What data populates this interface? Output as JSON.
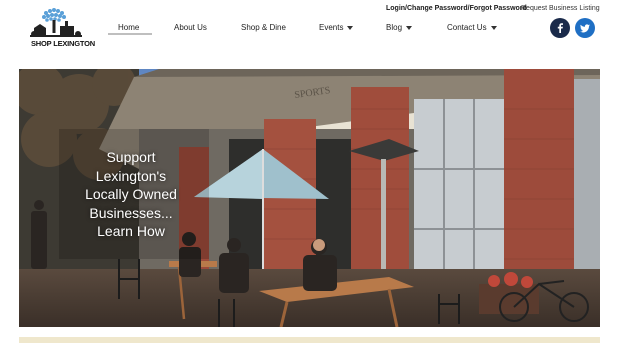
{
  "logo": {
    "text": "SHOP LEXINGTON",
    "icon": "tree-town-logo"
  },
  "utility": {
    "login_label": "Login/Change Password/Forgot Password",
    "request_label": "Request Business Listing"
  },
  "nav": {
    "home": "Home",
    "about": "About Us",
    "shop": "Shop & Dine",
    "events": "Events",
    "blog": "Blog",
    "contact": "Contact Us"
  },
  "social": {
    "facebook_icon": "facebook-icon",
    "twitter_icon": "twitter-icon"
  },
  "hero": {
    "sign_text": "SPORTS",
    "cta_lines": [
      "Support",
      "Lexington's",
      "Locally Owned",
      "Businesses...",
      "Learn How"
    ]
  },
  "colors": {
    "facebook": "#1a2a4a",
    "twitter": "#1f6fc4",
    "brick": "#9c4a3a",
    "footer_band": "#efe7cc"
  }
}
